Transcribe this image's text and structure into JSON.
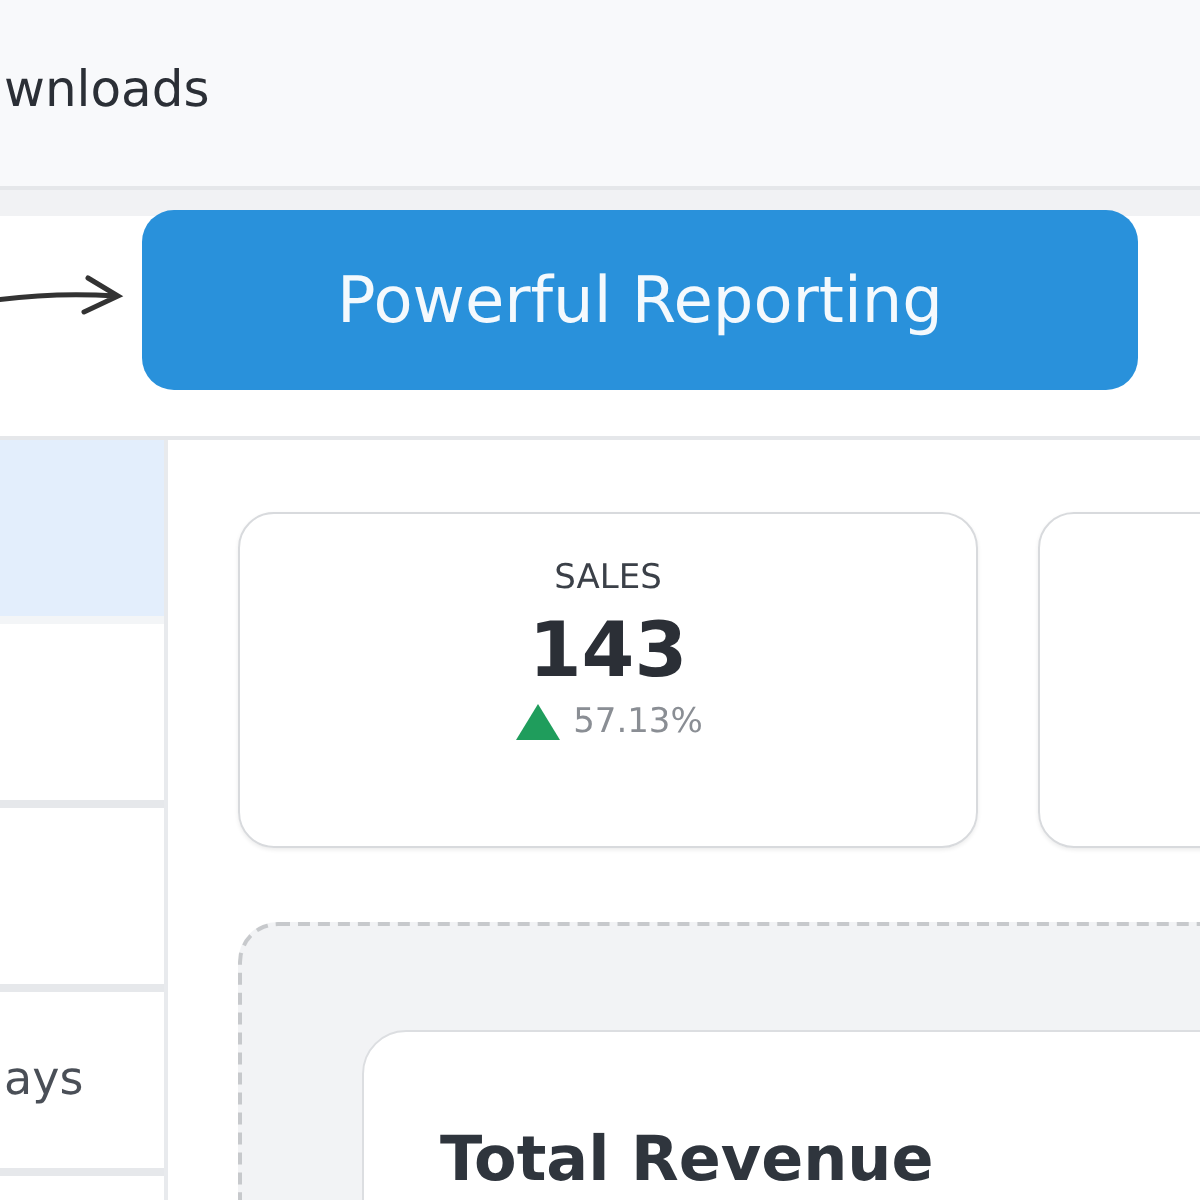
{
  "top_bar": {
    "label": "wnloads"
  },
  "banner": {
    "label": "Powerful Reporting"
  },
  "sidebar": {
    "items": [
      {
        "selected": true
      },
      {
        "selected": false
      },
      {
        "selected": false
      },
      {
        "label": "ays",
        "selected": false
      }
    ]
  },
  "stat_cards": [
    {
      "title": "SALES",
      "value": "143",
      "change": "57.13%"
    }
  ],
  "revenue_card": {
    "title": "Total Revenue"
  }
}
